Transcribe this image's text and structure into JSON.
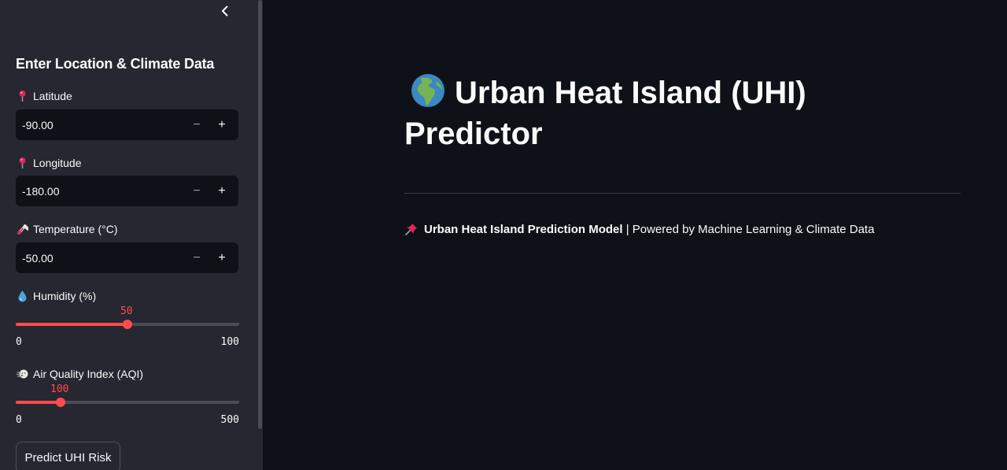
{
  "sidebar": {
    "header": "Enter Location & Climate Data",
    "fields": {
      "latitude": {
        "label": "Latitude",
        "value": "-90.00",
        "minus": "−",
        "plus": "+"
      },
      "longitude": {
        "label": "Longitude",
        "value": "-180.00",
        "minus": "−",
        "plus": "+"
      },
      "temperature": {
        "label": "Temperature (°C)",
        "value": "-50.00",
        "minus": "−",
        "plus": "+"
      }
    },
    "humidity": {
      "label": "Humidity (%)",
      "value": "50",
      "min": "0",
      "max": "100",
      "fraction": 0.5
    },
    "aqi": {
      "label": "Air Quality Index (AQI)",
      "value": "100",
      "min": "0",
      "max": "500",
      "fraction": 0.2
    },
    "predict_button": "Predict UHI Risk",
    "icons": {
      "collapse": "chevron-left-icon",
      "latitude": "round-pushpin-icon",
      "longitude": "round-pushpin-icon",
      "temperature": "thermometer-icon",
      "humidity": "droplet-icon",
      "aqi": "wind-face-icon"
    }
  },
  "main": {
    "title": "Urban Heat Island (UHI) Predictor",
    "title_icon": "globe-africa-europe-icon",
    "caption_icon": "pushpin-icon",
    "caption_bold": "Urban Heat Island Prediction Model",
    "caption_rest": " | Powered by Machine Learning & Climate Data"
  },
  "colors": {
    "accent": "#ff4b4b",
    "background": "#0e1117",
    "sidebar": "#262730"
  }
}
